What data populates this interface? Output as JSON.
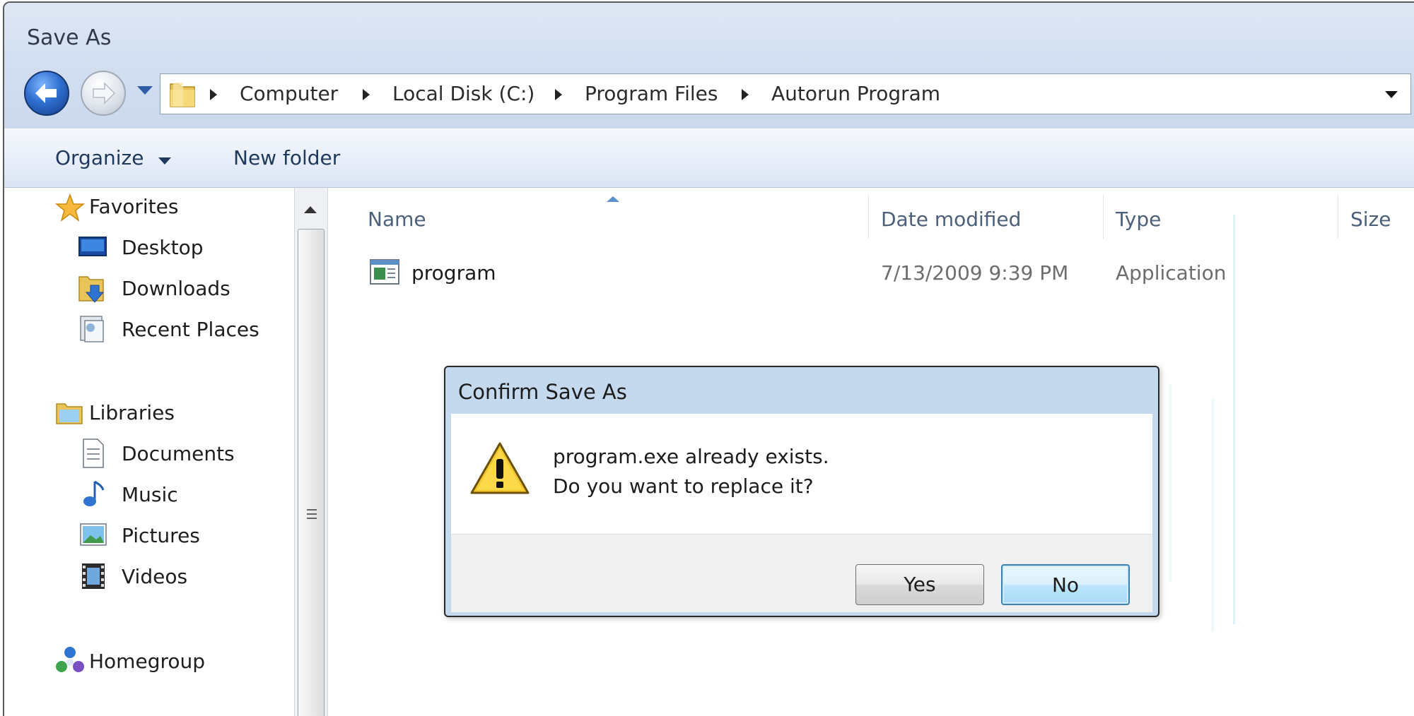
{
  "window": {
    "title": "Save As"
  },
  "address_bar": {
    "breadcrumbs": [
      "Computer",
      "Local Disk (C:)",
      "Program Files",
      "Autorun Program"
    ]
  },
  "toolbar": {
    "organize_label": "Organize",
    "new_folder_label": "New folder"
  },
  "nav_pane": {
    "favorites": {
      "label": "Favorites",
      "items": [
        "Desktop",
        "Downloads",
        "Recent Places"
      ]
    },
    "libraries": {
      "label": "Libraries",
      "items": [
        "Documents",
        "Music",
        "Pictures",
        "Videos"
      ]
    },
    "homegroup": {
      "label": "Homegroup"
    }
  },
  "file_list": {
    "columns": [
      "Name",
      "Date modified",
      "Type",
      "Size"
    ],
    "rows": [
      {
        "name": "program",
        "date_modified": "7/13/2009 9:39 PM",
        "type": "Application",
        "icon": "application-icon"
      }
    ]
  },
  "dialog": {
    "title": "Confirm Save As",
    "message_line1": "program.exe already exists.",
    "message_line2": "Do you want to replace it?",
    "icon": "warning-icon",
    "yes_label": "Yes",
    "no_label": "No"
  },
  "colors": {
    "chrome": "#d4e0f1",
    "accent": "#3c7fb1",
    "header_text": "#4c607a"
  }
}
